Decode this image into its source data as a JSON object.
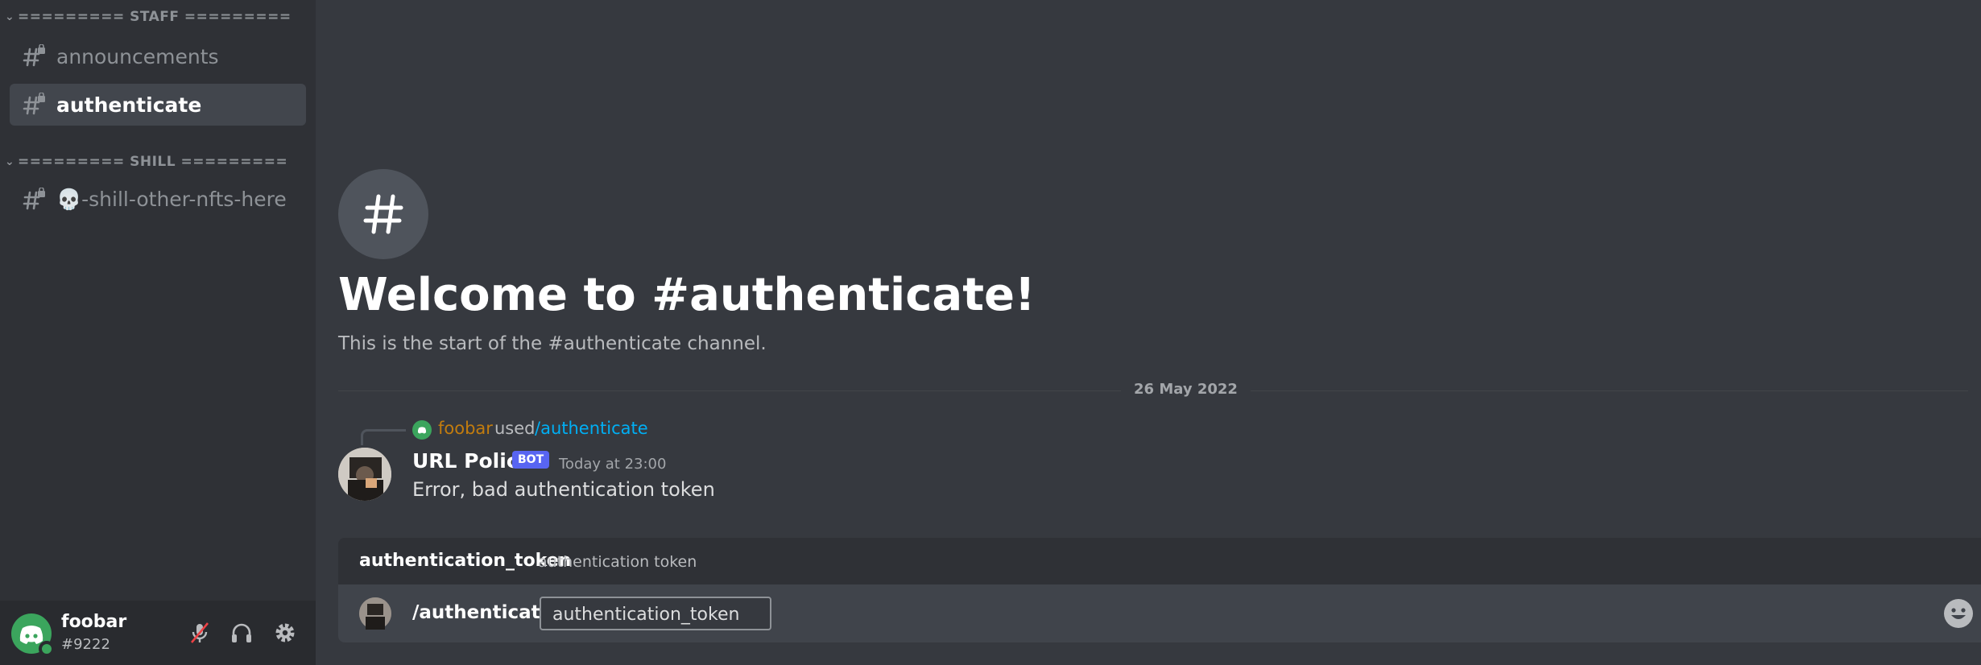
{
  "sidebar": {
    "categories": [
      {
        "label": "========= STAFF ========="
      },
      {
        "label": "========= SHILL ========="
      }
    ],
    "channels": [
      {
        "name": "announcements",
        "active": false
      },
      {
        "name": "authenticate",
        "active": true
      },
      {
        "name": "💀-shill-other-nfts-here",
        "active": false
      }
    ],
    "user": {
      "name": "foobar",
      "discriminator": "#9222",
      "status_color": "#3ba55c"
    },
    "controls": [
      "mute-mic-icon",
      "headphones-icon",
      "gear-icon"
    ]
  },
  "main": {
    "welcome_title": "Welcome to #authenticate!",
    "welcome_subtitle": "This is the start of the #authenticate channel.",
    "date_divider": "26 May 2022",
    "reply": {
      "user": "foobar",
      "used": "used",
      "command": "/authenticate"
    },
    "message": {
      "author": "URL Police",
      "bot_tag": "BOT",
      "timestamp": "Today at 23:00",
      "text": "Error, bad authentication token"
    },
    "command_option": {
      "name": "authentication_token",
      "description": "authentication token"
    },
    "composer": {
      "command": "/authenticate",
      "field_value": "authentication_token"
    }
  },
  "colors": {
    "accent_blurple": "#5865f2",
    "link": "#00aff4",
    "reply_user": "#c27c0e",
    "online": "#3ba55c"
  }
}
